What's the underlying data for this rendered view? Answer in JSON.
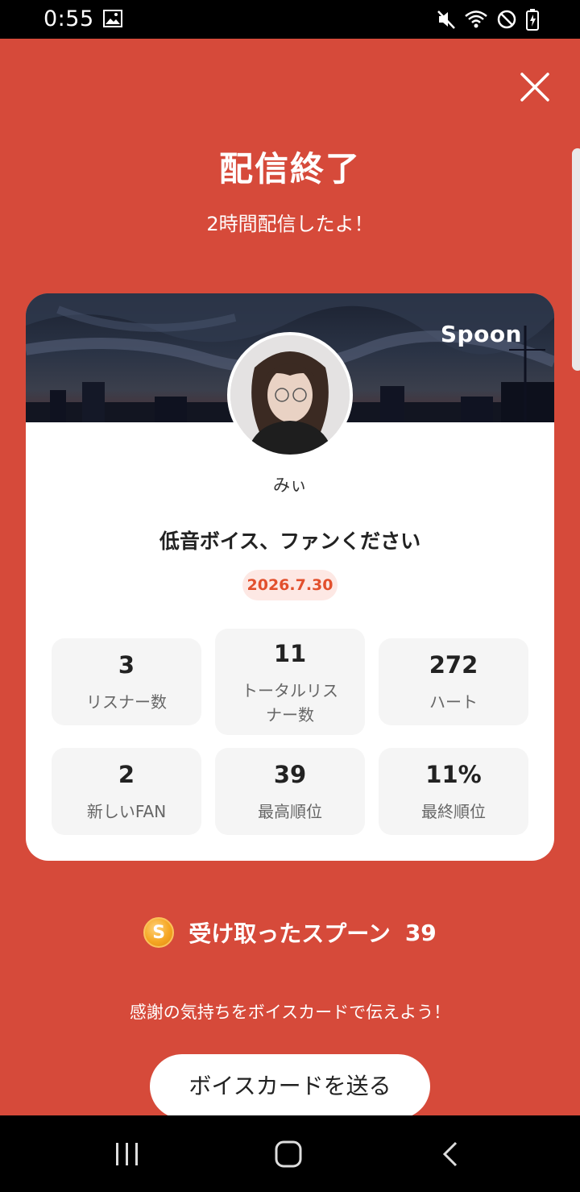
{
  "status_bar": {
    "time": "0:55",
    "icons": [
      "image-icon",
      "mute-icon",
      "wifi-icon",
      "do-not-disturb-icon",
      "battery-icon"
    ]
  },
  "header": {
    "title": "配信終了",
    "subtitle": "2時間配信したよ！"
  },
  "card": {
    "brand": "Spoon",
    "username": "みぃ",
    "broadcast_title": "低音ボイス、ファンください",
    "date": "2026.7.30",
    "stats": [
      {
        "value": "3",
        "label": "リスナー数"
      },
      {
        "value": "11",
        "label_line1": "トータルリス",
        "label_line2": "ナー数"
      },
      {
        "value": "272",
        "label": "ハート"
      },
      {
        "value": "2",
        "label": "新しいFAN"
      },
      {
        "value": "39",
        "label": "最高順位"
      },
      {
        "value": "11%",
        "label": "最終順位"
      }
    ]
  },
  "spoons": {
    "coin_letter": "S",
    "label": "受け取ったスプーン",
    "count": "39"
  },
  "footer": {
    "thanks_text": "感謝の気持ちをボイスカードで伝えよう！",
    "voice_card_button": "ボイスカードを送る"
  },
  "colors": {
    "background": "#d64a3a",
    "accent": "#e2502d",
    "badge_bg": "#fde8e4",
    "coin": "#f5a623"
  }
}
